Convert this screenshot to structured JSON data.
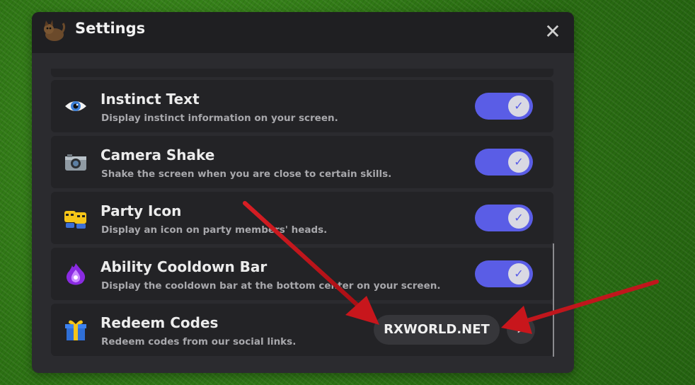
{
  "window": {
    "title": "Settings",
    "close_glyph": "✕"
  },
  "settings": [
    {
      "icon": "eye-icon",
      "title": "Instinct Text",
      "description": "Display instinct information on your screen.",
      "enabled": true
    },
    {
      "icon": "camera-icon",
      "title": "Camera Shake",
      "description": "Shake the screen when you are close to certain skills.",
      "enabled": true
    },
    {
      "icon": "party-icon",
      "title": "Party Icon",
      "description": "Display an icon on party members' heads.",
      "enabled": true
    },
    {
      "icon": "purple-flame-icon",
      "title": "Ability Cooldown Bar",
      "description": "Display the cooldown bar at the bottom center on your screen.",
      "enabled": true
    }
  ],
  "redeem": {
    "icon": "gift-icon",
    "title": "Redeem Codes",
    "description": "Redeem codes from our social links.",
    "code_value": "RXWORLD.NET",
    "submit_glyph": "▶"
  },
  "toggle_glyph": "✓",
  "colors": {
    "accent": "#5a5de6",
    "panel": "#2b2b2f",
    "row": "#232326",
    "arrow": "#c0141a"
  }
}
